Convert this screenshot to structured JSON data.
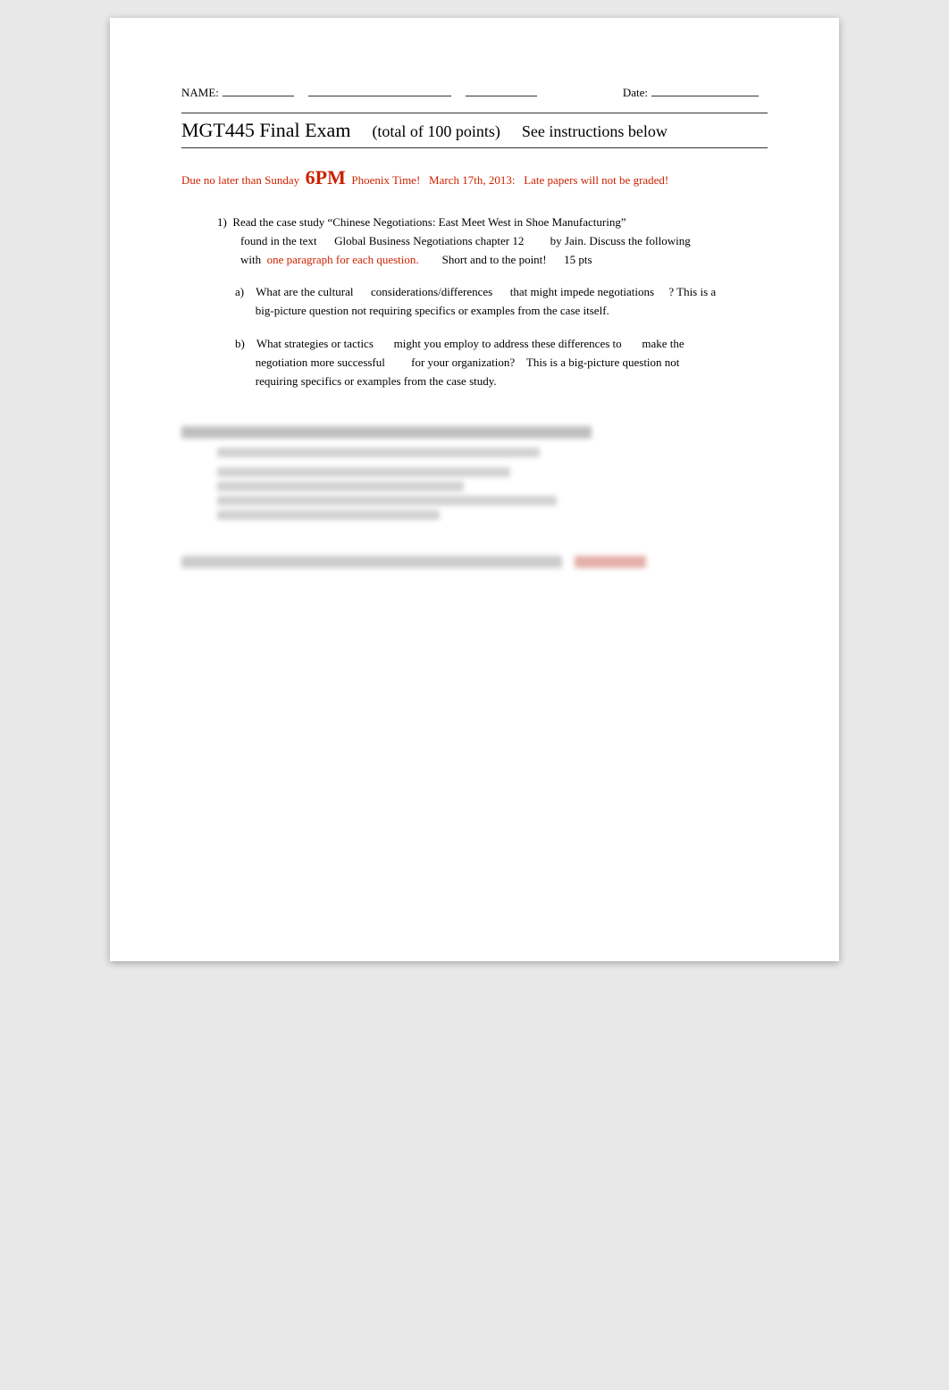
{
  "header": {
    "name_label": "NAME:",
    "date_label": "Date:"
  },
  "title": {
    "exam_name": "MGT445 Final Exam",
    "total_points": "(total of 100 points)",
    "see_instructions": "See instructions below"
  },
  "due_notice": {
    "prefix": "Due no later than Sunday",
    "time": "6PM",
    "suffix": "Phoenix Time!",
    "date_info": "March 17th, 2013:",
    "late_warning": "Late papers will not be graded!"
  },
  "question1": {
    "number": "1)",
    "line1": "Read the case study “Chinese Negotiations: East Meet West in Shoe Manufacturing”",
    "line2_part1": "found in the text",
    "line2_part2": "Global Business Negotiations chapter 12",
    "line2_part3": "by Jain. Discuss the following",
    "line3_part1": "with",
    "line3_red": "one paragraph for each question.",
    "line3_part2": "Short and to the point!",
    "line3_points": "15 pts"
  },
  "sub_a": {
    "label": "a)",
    "line1_part1": "What are the cultural",
    "line1_part2": "considerations/differences",
    "line1_part3": "that might impede negotiations",
    "line1_part4": "? This is a",
    "line2": "big-picture question not requiring specifics or examples from the case itself."
  },
  "sub_b": {
    "label": "b)",
    "line1_part1": "What strategies or tactics",
    "line1_part2": "might you employ to address these differences to",
    "line1_part3": "make the",
    "line2_part1": "negotiation more successful",
    "line2_part2": "for your organization?",
    "line2_part3": "This is a big-picture question not",
    "line3": "requiring specifics or examples from the case study."
  }
}
